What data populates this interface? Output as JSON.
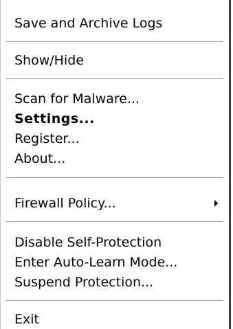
{
  "menu": {
    "items": {
      "save_archive_logs": "Save and Archive Logs",
      "show_hide": "Show/Hide",
      "scan_for_malware": "Scan for Malware...",
      "settings": "Settings...",
      "register": "Register...",
      "about": "About...",
      "firewall_policy": "Firewall Policy...",
      "disable_self_protection": "Disable Self-Protection",
      "enter_auto_learn": "Enter Auto-Learn Mode...",
      "suspend_protection": "Suspend Protection...",
      "exit": "Exit"
    },
    "default_item": "Settings...",
    "firewall_policy_icon": "chevron-right-icon"
  }
}
